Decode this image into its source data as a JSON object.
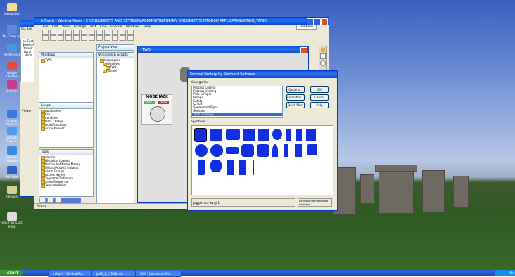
{
  "desktop_icons": [
    {
      "label": "Interactive",
      "color": "#f5e08a"
    },
    {
      "label": "My Computer",
      "color": "#5c8ad8"
    },
    {
      "label": "My Network",
      "color": "#4a9ae0"
    },
    {
      "label": "Google Chrome",
      "color": "#e64a3a"
    },
    {
      "label": "Unlocker",
      "color": "#c83a8a"
    },
    {
      "label": "Acrobat Programs",
      "color": "#3a7ad8"
    },
    {
      "label": "Intouch Explorer",
      "color": "#4aa0e8"
    },
    {
      "label": "Intouch Window",
      "color": "#3a8ae0"
    },
    {
      "label": "WinFinder",
      "color": "#3060c0"
    },
    {
      "label": "Recycle",
      "color": "#d8d090"
    }
  ],
  "shortcut": {
    "label": "YOU CAN SAVE HERE"
  },
  "main_window": {
    "title": "InTouch - WindowMaker - C:\\DOCUMENTS AND SETTINGS\\ADMINISTRATOR\\MY DOCUMENTS\\INTOUCH APPLICATIONS\\TWO_TANKS",
    "menu": [
      "File",
      "Edit",
      "View",
      "Arrange",
      "Text",
      "Line",
      "Special",
      "Windows",
      "Help"
    ],
    "runtime": "Runtime",
    "status": "Ready"
  },
  "left_app": {
    "menu": [
      "File",
      "Acti"
    ],
    "tree": [
      "eA System Pl",
      "Server Manag",
      "Default Grou",
      "Local",
      "Arch"
    ],
    "viewer": "Viewer"
  },
  "panes": {
    "windows": {
      "title": "Windows",
      "items": [
        "TWO"
      ]
    },
    "script_tree": {
      "title": "Windows & Scripts",
      "items": [
        "Unassigned",
        "Windows",
        "TWO",
        "Scripts"
      ]
    },
    "project": {
      "title": "Project View"
    },
    "tools_label": "Tools",
    "scripts": {
      "title": "Scripts",
      "items": [
        "Application",
        "Key",
        "Condition",
        "Data Change",
        "QuickFunctions",
        "ActiveX Event"
      ]
    },
    "tools": {
      "items": [
        "Alarms",
        "Historical Logging",
        "Distributed Name Manag",
        "Wizard/ActiveX Installat",
        "Alarm Groups",
        "Access Names",
        "Tagname Dictionary",
        "Cross Reference",
        "TemplateMaker"
      ]
    }
  },
  "two_window": {
    "title": "TWO",
    "mode_label": "MODE JACK",
    "auto": "AUTO",
    "manu": "MANU"
  },
  "symbol_factory": {
    "title": "Symbol Factory by Reichard Software",
    "categories_label": "Categories",
    "categories": [
      "Process Cooling",
      "Process Heating",
      "Pulp & Paper",
      "Pumps",
      "Safety",
      "Scales",
      "Segmented Pipes",
      "Sensors",
      "Tank Drawings"
    ],
    "selected_category": "Tank Drawings",
    "buttons": [
      "Options...",
      "OK",
      "Animation...",
      "Cancel",
      "Quick Start",
      "Help"
    ],
    "symbols_label": "Symbols",
    "symbol_color": "#1030e0",
    "status": "Jagged cut-away 1",
    "license": "Licensed from Reichard Software"
  },
  "taskbar": {
    "start": "start",
    "tasks": [
      "InTouch - WindowMa...",
      "JACK_1_2_TANK.vip - ...",
      "SMC - [ArchestrA Sys..."
    ],
    "tray": "EN"
  }
}
